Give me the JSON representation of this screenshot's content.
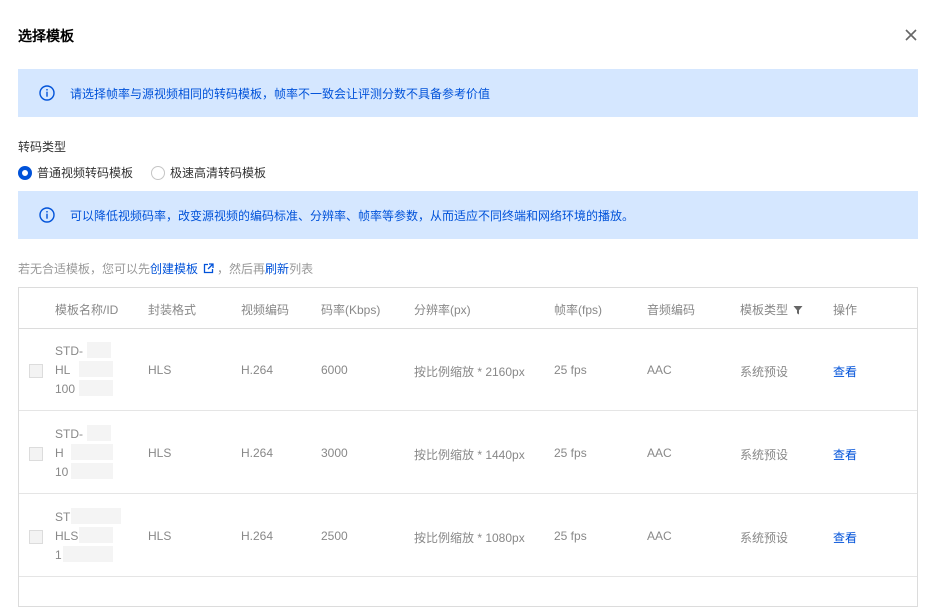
{
  "dialog": {
    "title": "选择模板",
    "close_icon": "close-icon"
  },
  "alert_top": {
    "icon": "info-icon",
    "text": "请选择帧率与源视频相同的转码模板，帧率不一致会让评测分数不具备参考价值"
  },
  "transcode_type": {
    "label": "转码类型",
    "options": [
      {
        "label": "普通视频转码模板",
        "selected": true
      },
      {
        "label": "极速高清转码模板",
        "selected": false
      }
    ]
  },
  "alert_desc": {
    "icon": "info-icon",
    "text": "可以降低视频码率，改变源视频的编码标准、分辨率、帧率等参数，从而适应不同终端和网络环境的播放。"
  },
  "hint": {
    "prefix": "若无合适模板，您可以先",
    "create_link": "创建模板",
    "middle": "，然后再",
    "refresh_link": "刷新",
    "suffix": "列表"
  },
  "table": {
    "headers": {
      "name": "模板名称/ID",
      "container": "封装格式",
      "video_codec": "视频编码",
      "bitrate": "码率(Kbps)",
      "resolution": "分辨率(px)",
      "fps": "帧率(fps)",
      "audio_codec": "音频编码",
      "type": "模板类型",
      "action": "操作"
    },
    "rows": [
      {
        "name_lines": [
          "STD-",
          "HL",
          "100"
        ],
        "container": "HLS",
        "video_codec": "H.264",
        "bitrate": "6000",
        "resolution": "按比例缩放 * 2160px",
        "fps": "25 fps",
        "audio_codec": "AAC",
        "type": "系统预设",
        "action": "查看"
      },
      {
        "name_lines": [
          "STD-",
          "H",
          "10"
        ],
        "container": "HLS",
        "video_codec": "H.264",
        "bitrate": "3000",
        "resolution": "按比例缩放 * 1440px",
        "fps": "25 fps",
        "audio_codec": "AAC",
        "type": "系统预设",
        "action": "查看"
      },
      {
        "name_lines": [
          "ST",
          "HLS",
          "1"
        ],
        "container": "HLS",
        "video_codec": "H.264",
        "bitrate": "2500",
        "resolution": "按比例缩放 * 1080px",
        "fps": "25 fps",
        "audio_codec": "AAC",
        "type": "系统预设",
        "action": "查看"
      }
    ]
  },
  "colors": {
    "accent": "#0052d9",
    "alert_bg": "#d5e7ff"
  }
}
